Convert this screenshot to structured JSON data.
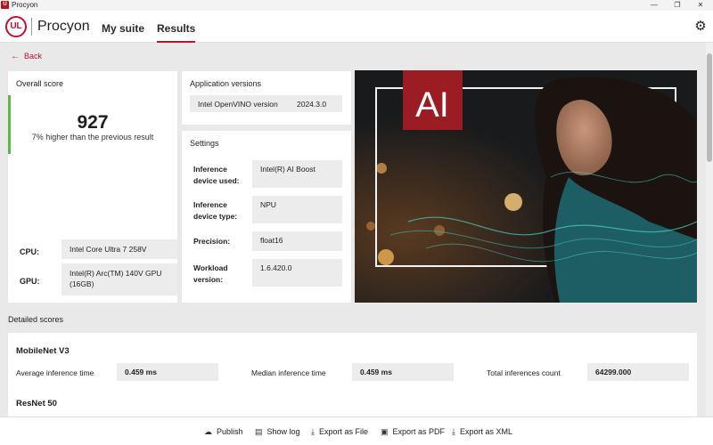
{
  "window": {
    "title": "Procyon",
    "app_icon_letter": "U",
    "controls": {
      "minimize": "—",
      "maximize": "❐",
      "close": "✕"
    }
  },
  "header": {
    "logo_text": "UL",
    "brand": "Procyon",
    "tabs": [
      {
        "label": "My suite",
        "active": false
      },
      {
        "label": "Results",
        "active": true
      }
    ],
    "settings_icon": "gear-icon"
  },
  "back_label": "Back",
  "overall": {
    "title": "Overall score",
    "score": "927",
    "comparison": "7% higher than the previous result",
    "accent_color": "#58b947",
    "cpu_label": "CPU:",
    "cpu_value": "Intel Core Ultra 7 258V",
    "gpu_label": "GPU:",
    "gpu_value": "Intel(R) Arc(TM) 140V GPU (16GB)"
  },
  "app_versions": {
    "title": "Application versions",
    "name": "Intel OpenVINO version",
    "version": "2024.3.0"
  },
  "settings": {
    "title": "Settings",
    "rows": [
      {
        "label": "Inference device used:",
        "value": "Intel(R) AI Boost"
      },
      {
        "label": "Inference device type:",
        "value": "NPU"
      },
      {
        "label": "Precision:",
        "value": "float16"
      },
      {
        "label": "Workload version:",
        "value": "1.6.420.0"
      }
    ]
  },
  "promo": {
    "logo_text": "AI",
    "accent_color": "#9c1c24"
  },
  "detailed": {
    "title": "Detailed scores",
    "models": [
      {
        "name": "MobileNet V3",
        "avg_label": "Average inference time",
        "avg_value": "0.459 ms",
        "median_label": "Median inference time",
        "median_value": "0.459 ms",
        "count_label": "Total inferences count",
        "count_value": "64299.000"
      },
      {
        "name": "ResNet 50"
      }
    ]
  },
  "footer": {
    "buttons": [
      {
        "label": "Publish",
        "icon": "cloud-upload-icon"
      },
      {
        "label": "Show log",
        "icon": "document-icon"
      },
      {
        "label": "Export as File",
        "icon": "download-icon"
      },
      {
        "label": "Export as PDF",
        "icon": "save-icon"
      },
      {
        "label": "Export as XML",
        "icon": "download-icon"
      }
    ]
  },
  "colors": {
    "brand_red": "#c8102e",
    "panel_bg": "#ececec",
    "page_bg": "#e9e9ea"
  }
}
